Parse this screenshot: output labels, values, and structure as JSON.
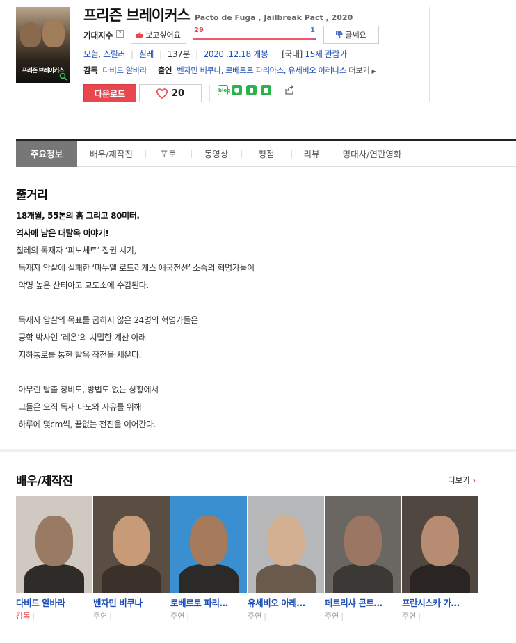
{
  "movie": {
    "title": "프리즌 브레이커스",
    "original_title": "Pacto de Fuga , Jailbreak Pact , 2020",
    "poster_title": "프리즌 브레이커스"
  },
  "expectation": {
    "label": "기대지수",
    "want_label": "보고싶어요",
    "meh_label": "글쎄요",
    "want_count": "29",
    "meh_count": "1",
    "want_ratio": 0.97
  },
  "info": {
    "genre": "모험, 스릴러",
    "country": "칠레",
    "runtime": "137분",
    "release": "2020 .12.18 개봉",
    "rating_prefix": "[국내]",
    "rating": "15세 관람가",
    "director_label": "감독",
    "director": "다비드 알바라",
    "cast_label": "출연",
    "cast_list": "벤자민 비쿠나, 로베르토 파리아스, 유세비오 아레나스",
    "more": "더보기"
  },
  "actions": {
    "download": "다운로드",
    "like_count": "20",
    "blog_icon_text": "blog"
  },
  "tabs": [
    {
      "label": "주요정보",
      "active": true
    },
    {
      "label": "배우/제작진"
    },
    {
      "label": "포토"
    },
    {
      "label": "동영상"
    },
    {
      "label": "평점"
    },
    {
      "label": "리뷰"
    },
    {
      "label": "명대사/연관영화"
    }
  ],
  "synopsis": {
    "heading": "줄거리",
    "lines": [
      {
        "text": "18개월, 55톤의 흙 그리고 80미터.",
        "bold": true
      },
      {
        "text": "역사에 남은 대탈옥 이야기!",
        "bold": true
      },
      {
        "text": "칠레의 독재자 ‘피노체트’ 집권 시기,"
      },
      {
        "text": " 독재자 암살에 실패한 ‘마누엘 로드리게스 애국전선’ 소속의 혁명가들이"
      },
      {
        "text": " 악명 높은 산티아고 교도소에 수감된다."
      },
      {
        "text": ""
      },
      {
        "text": " 독재자 암살의 목표를 굽히지 않은 24명의 혁명가들은"
      },
      {
        "text": " 공학 박사인 ‘레온’의 치밀한 계산 아래"
      },
      {
        "text": " 지하통로를 통한 탈옥 작전을 세운다."
      },
      {
        "text": ""
      },
      {
        "text": " 아무런 탈출 장비도, 방법도 없는 상황에서"
      },
      {
        "text": " 그들은 오직 독재 타도와 자유를 위해"
      },
      {
        "text": " 하루에 몇cm씩, 끝없는 전진을 이어간다."
      }
    ]
  },
  "cast": {
    "heading": "배우/제작진",
    "more": "더보기",
    "people": [
      {
        "name": "다비드 알바라",
        "role": "감독",
        "bg": "#cfc9c2",
        "head": "#9a7a63",
        "body": "#2e2b29"
      },
      {
        "name": "벤자민 비쿠나",
        "role": "주연",
        "bg": "#5a4e43",
        "head": "#c79a78",
        "body": "#3b302a"
      },
      {
        "name": "로베르토 파리…",
        "role": "주연",
        "bg": "#3a8fd0",
        "head": "#a57b5c",
        "body": "#2c2a29"
      },
      {
        "name": "유세비오 아레…",
        "role": "주연",
        "bg": "#b6b8ba",
        "head": "#d4b093",
        "body": "#6a5a4c"
      },
      {
        "name": "페트리샤 콘트…",
        "role": "주연",
        "bg": "#6a6762",
        "head": "#9b7763",
        "body": "#3b3836"
      },
      {
        "name": "프란시스카 가…",
        "role": "주연",
        "bg": "#4f4740",
        "head": "#b88c73",
        "body": "#2a2522"
      }
    ]
  }
}
